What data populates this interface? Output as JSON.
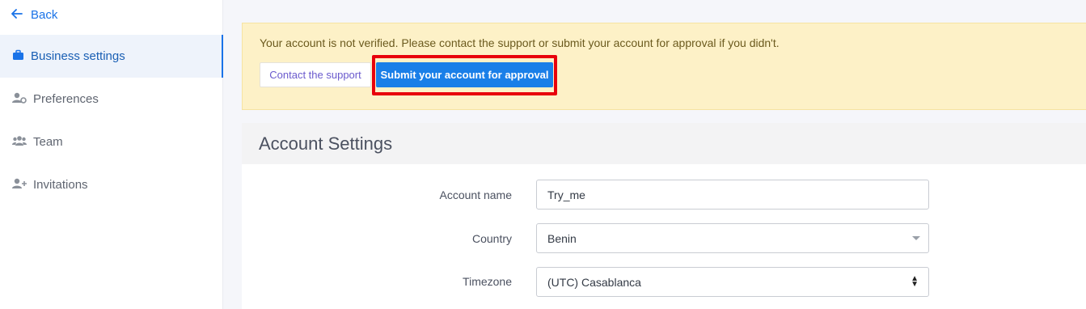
{
  "sidebar": {
    "back_label": "Back",
    "items": [
      {
        "label": "Business settings",
        "icon": "briefcase-icon",
        "active": true
      },
      {
        "label": "Preferences",
        "icon": "user-gear-icon",
        "active": false
      },
      {
        "label": "Team",
        "icon": "users-icon",
        "active": false
      },
      {
        "label": "Invitations",
        "icon": "user-plus-icon",
        "active": false
      }
    ]
  },
  "banner": {
    "message": "Your account is not verified. Please contact the support or submit your account for approval if you didn't.",
    "contact_label": "Contact the support",
    "submit_label": "Submit your account for approval"
  },
  "account_settings": {
    "title": "Account Settings",
    "fields": {
      "account_name": {
        "label": "Account name",
        "value": "Try_me"
      },
      "country": {
        "label": "Country",
        "value": "Benin"
      },
      "timezone": {
        "label": "Timezone",
        "value": "(UTC) Casablanca"
      }
    }
  },
  "colors": {
    "accent": "#1a73e8",
    "banner_bg": "#fdf1c7",
    "highlight": "#e8000b"
  }
}
